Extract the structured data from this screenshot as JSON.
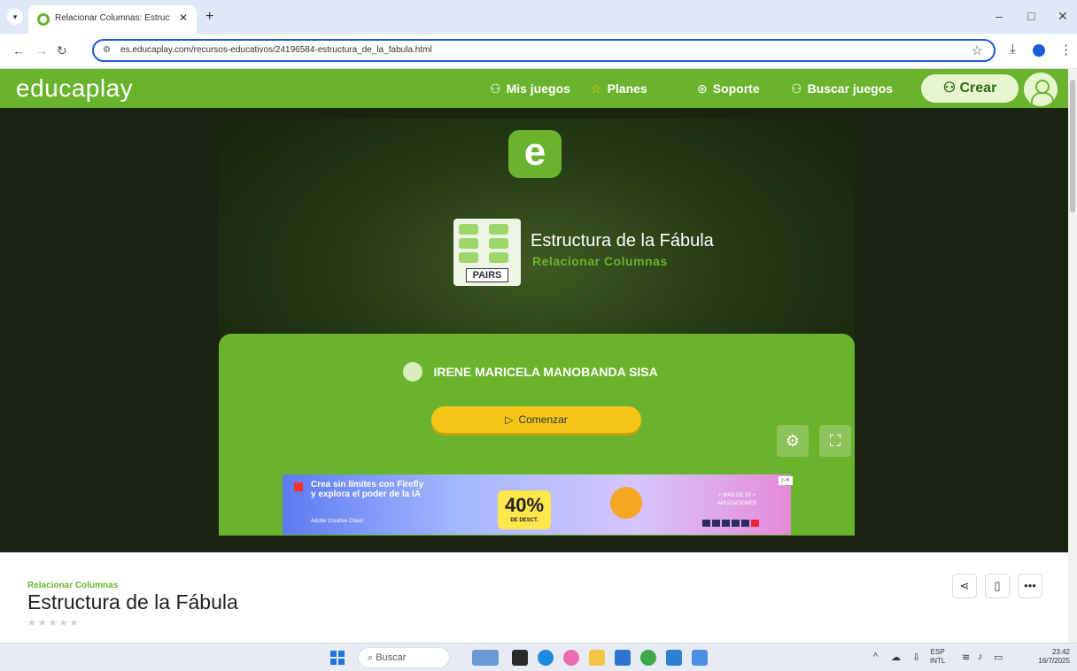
{
  "browser": {
    "tab_title": "Relacionar Columnas: Estructur",
    "tab_close": "✕",
    "new_tab": "+",
    "url": "es.educaplay.com/recursos-educativos/24196584-estructura_de_la_fabula.html",
    "window_controls": [
      "–",
      "□",
      "✕"
    ]
  },
  "header": {
    "logo": "educaplay",
    "nav": [
      {
        "icon": "gamepad-icon",
        "label": "Mis juegos"
      },
      {
        "icon": "star-icon",
        "label": "Planes"
      },
      {
        "icon": "support-icon",
        "label": "Soporte"
      },
      {
        "icon": "search-games-icon",
        "label": "Buscar juegos"
      }
    ],
    "create_label": "Crear"
  },
  "game": {
    "logo_letter": "e",
    "pairs_badge": "PAIRS",
    "title": "Estructura de la Fábula",
    "subtitle": "Relacionar Columnas",
    "author": "IRENE MARICELA MANOBANDA SISA",
    "start_label": "Comenzar"
  },
  "ad": {
    "line1": "Crea sin límites con Firefly",
    "line2": "y explora el poder de la IA",
    "brand": "Adobe Creative Cloud",
    "percent": "40%",
    "discount": "DE DESCT.",
    "right_line1": "+ MÁS DE 20 +",
    "right_line2": "APLICACIONES"
  },
  "activity": {
    "type": "Relacionar Columnas",
    "title": "Estructura de la Fábula",
    "rating_stars": "★★★★★"
  },
  "taskbar": {
    "search_label": "Buscar",
    "lang_top": "ESP",
    "lang_bottom": "INTL",
    "time": "23:42",
    "date": "16/7/2025"
  },
  "colors": {
    "brand_green": "#6ab42d",
    "start_yellow": "#f5c518",
    "dark_bg": "#1a2410"
  }
}
